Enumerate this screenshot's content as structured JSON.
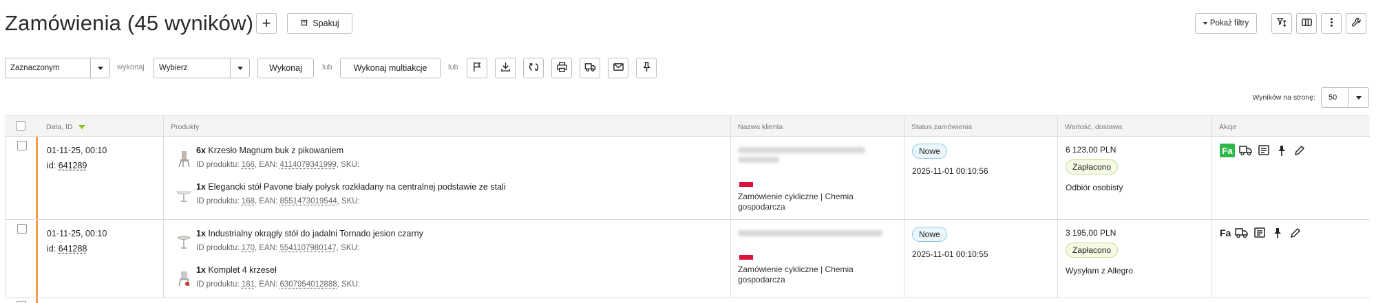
{
  "header": {
    "title": "Zamówienia (45 wyników)",
    "add_label": "+",
    "pack_label": "Spakuj",
    "filters_label": "Pokaż filtry"
  },
  "toolbar": {
    "selection_value": "Zaznaczonym",
    "execute_label": "wykonaj",
    "action_placeholder": "Wybierz",
    "execute_button": "Wykonaj",
    "or_label_1": "lub",
    "multi_button": "Wykonaj multiakcje",
    "or_label_2": "lub",
    "icons": [
      "flag-icon",
      "download-icon",
      "sync-icon",
      "print-icon",
      "truck-icon",
      "mail-icon",
      "pin-icon"
    ]
  },
  "pagination": {
    "per_page_label": "Wyników na stronę:",
    "per_page_value": "50"
  },
  "table": {
    "columns": [
      "Data, ID",
      "Produkty",
      "Nazwa klienta",
      "Status zamówienia",
      "Wartość, dostawa",
      "Akcje"
    ],
    "rows": [
      {
        "date": "01-11-25, 00:10",
        "id_prefix": "id: ",
        "id": "641289",
        "products": [
          {
            "qty": "6x",
            "name": "Krzesło Magnum buk z pikowaniem",
            "meta_prefix": "ID produktu: ",
            "product_id": "166",
            "ean_prefix": ", EAN: ",
            "ean": "4114079341999",
            "sku": ", SKU:"
          },
          {
            "qty": "1x",
            "name": "Elegancki stół Pavone biały połysk rozkładany na centralnej podstawie ze stali",
            "meta_prefix": "ID produktu: ",
            "product_id": "168",
            "ean_prefix": ", EAN: ",
            "ean": "8551473019544",
            "sku": ", SKU:"
          }
        ],
        "client_tag": "Zamówienie cykliczne | Chemia gospodarcza",
        "status": "Nowe",
        "status_date": "2025-11-01 00:10:56",
        "amount": "6 123,00 PLN",
        "payment": "Zapłacono",
        "delivery": "Odbiór osobisty",
        "invoice_state": "issued"
      },
      {
        "date": "01-11-25, 00:10",
        "id_prefix": "id: ",
        "id": "641288",
        "products": [
          {
            "qty": "1x",
            "name": "Industrialny okrągły stół do jadalni Tornado jesion czarny",
            "meta_prefix": "ID produktu: ",
            "product_id": "170",
            "ean_prefix": ", EAN: ",
            "ean": "5541107980147",
            "sku": ", SKU:"
          },
          {
            "qty": "1x",
            "name": "Komplet 4 krzeseł",
            "meta_prefix": "ID produktu: ",
            "product_id": "181",
            "ean_prefix": ", EAN: ",
            "ean": "6307954012888",
            "sku": ", SKU:"
          }
        ],
        "client_tag": "Zamówienie cykliczne | Chemia gospodarcza",
        "status": "Nowe",
        "status_date": "2025-11-01 00:10:55",
        "amount": "3 195,00 PLN",
        "payment": "Zapłacono",
        "delivery": "Wysyłam z Allegro",
        "invoice_state": "none"
      }
    ],
    "invoice_label": "Fa"
  },
  "colors": {
    "accent_bar": "#f59a45",
    "invoice_green": "#2db84a",
    "sort_arrow": "#8bbd1c",
    "badge_new_border": "#8ec9e6",
    "badge_paid_border": "#c5dd8b",
    "flag_red": "#dc143c"
  }
}
